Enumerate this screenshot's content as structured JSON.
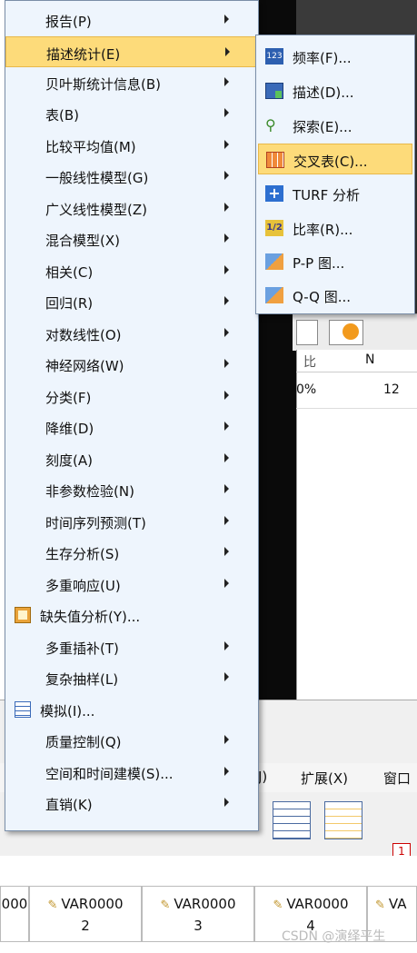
{
  "main_menu": {
    "items": [
      {
        "label": "报告(P)",
        "submenu": true
      },
      {
        "label": "描述统计(E)",
        "submenu": true,
        "highlighted": true
      },
      {
        "label": "贝叶斯统计信息(B)",
        "submenu": true
      },
      {
        "label": "表(B)",
        "submenu": true
      },
      {
        "label": "比较平均值(M)",
        "submenu": true
      },
      {
        "label": "一般线性模型(G)",
        "submenu": true
      },
      {
        "label": "广义线性模型(Z)",
        "submenu": true
      },
      {
        "label": "混合模型(X)",
        "submenu": true
      },
      {
        "label": "相关(C)",
        "submenu": true
      },
      {
        "label": "回归(R)",
        "submenu": true
      },
      {
        "label": "对数线性(O)",
        "submenu": true
      },
      {
        "label": "神经网络(W)",
        "submenu": true
      },
      {
        "label": "分类(F)",
        "submenu": true
      },
      {
        "label": "降维(D)",
        "submenu": true
      },
      {
        "label": "刻度(A)",
        "submenu": true
      },
      {
        "label": "非参数检验(N)",
        "submenu": true
      },
      {
        "label": "时间序列预测(T)",
        "submenu": true
      },
      {
        "label": "生存分析(S)",
        "submenu": true
      },
      {
        "label": "多重响应(U)",
        "submenu": true
      },
      {
        "label": "缺失值分析(Y)...",
        "submenu": false,
        "icon": "missing-values-icon"
      },
      {
        "label": "多重插补(T)",
        "submenu": true
      },
      {
        "label": "复杂抽样(L)",
        "submenu": true
      },
      {
        "label": "模拟(I)...",
        "submenu": false,
        "icon": "simulation-icon"
      },
      {
        "label": "质量控制(Q)",
        "submenu": true
      },
      {
        "label": "空间和时间建模(S)...",
        "submenu": true
      },
      {
        "label": "直销(K)",
        "submenu": true
      }
    ]
  },
  "sub_menu": {
    "items": [
      {
        "label": "频率(F)...",
        "icon": "frequencies-icon"
      },
      {
        "label": "描述(D)...",
        "icon": "descriptives-icon"
      },
      {
        "label": "探索(E)...",
        "icon": "explore-icon"
      },
      {
        "label": "交叉表(C)...",
        "icon": "crosstabs-icon",
        "highlighted": true
      },
      {
        "label": "TURF 分析",
        "icon": "turf-icon"
      },
      {
        "label": "比率(R)...",
        "icon": "ratio-icon"
      },
      {
        "label": "P-P 图...",
        "icon": "pp-plot-icon"
      },
      {
        "label": "Q-Q 图...",
        "icon": "qq-plot-icon"
      }
    ]
  },
  "output": {
    "header_left": "比",
    "header_right": "N",
    "row_left": "0%",
    "row_right": "12"
  },
  "menubar": {
    "frag": "J)",
    "extensions": "扩展(X)",
    "window": "窗口"
  },
  "grid": {
    "headers": [
      {
        "line1": "000",
        "line2": ""
      },
      {
        "line1": "VAR0000",
        "line2": "2"
      },
      {
        "line1": "VAR0000",
        "line2": "3"
      },
      {
        "line1": "VAR0000",
        "line2": "4"
      },
      {
        "line1": "VA",
        "line2": ""
      }
    ]
  },
  "watermark": "CSDN @演绎平生",
  "colors": {
    "menu_bg": "#eef5fd",
    "highlight": "#fddb7a",
    "highlight_border": "#e8b84a"
  }
}
